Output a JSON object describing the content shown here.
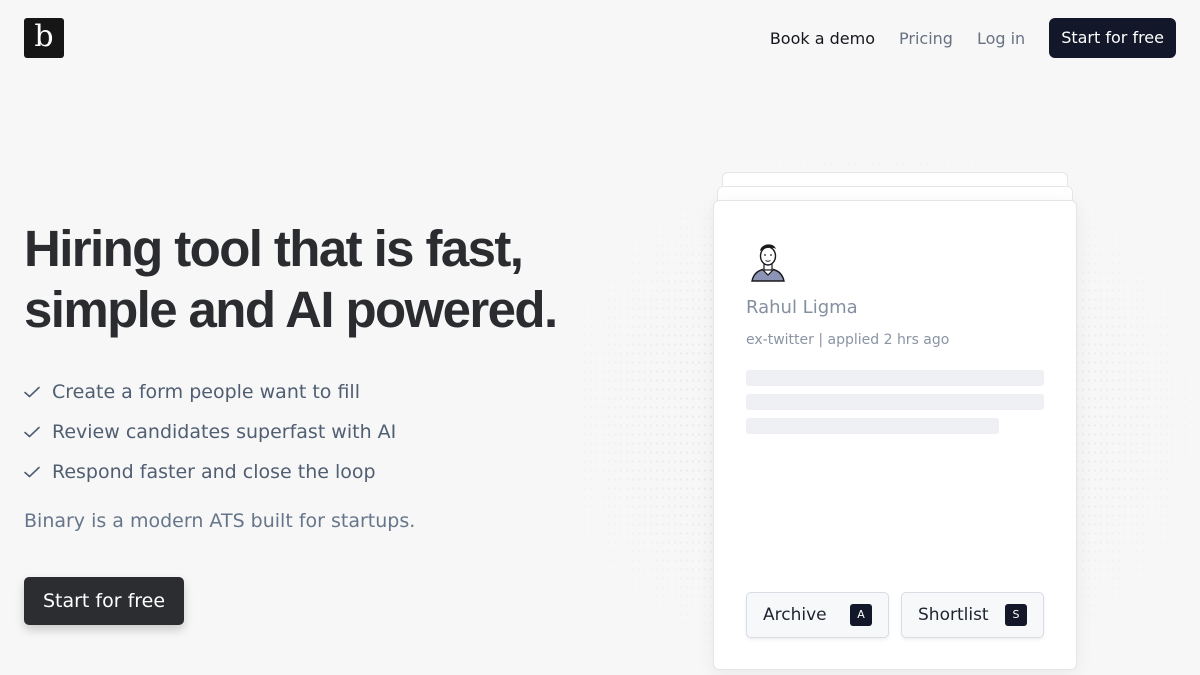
{
  "logo": {
    "letter": "b"
  },
  "nav": {
    "book_demo": "Book a demo",
    "pricing": "Pricing",
    "login": "Log in",
    "cta": "Start for free"
  },
  "hero": {
    "headline_line1": "Hiring tool that is fast,",
    "headline_line2": "simple and AI powered.",
    "features": [
      "Create a form people want to fill",
      "Review candidates superfast with AI",
      "Respond faster and close the loop"
    ],
    "tagline": "Binary is a modern ATS built for startups.",
    "cta": "Start for free"
  },
  "candidate_card": {
    "name": "Rahul Ligma",
    "meta": "ex-twitter | applied 2 hrs ago",
    "archive_label": "Archive",
    "archive_key": "A",
    "shortlist_label": "Shortlist",
    "shortlist_key": "S"
  },
  "colors": {
    "background": "#f7f7f7",
    "primary_dark": "#12172a",
    "heading": "#2b2c30",
    "body_text": "#505e72",
    "muted": "#8490a1"
  },
  "icons": {
    "check": "check-icon",
    "avatar": "avatar-illustration"
  }
}
